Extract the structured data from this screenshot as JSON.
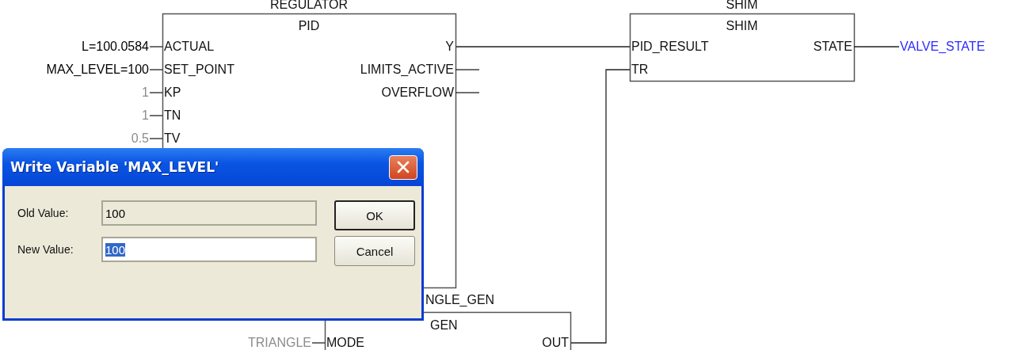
{
  "diagram": {
    "blocks": [
      {
        "instance": "REGULATOR",
        "type": "PID",
        "inputs": [
          {
            "pin": "ACTUAL",
            "value": "L=100.0584",
            "kind": "variable"
          },
          {
            "pin": "SET_POINT",
            "value": "MAX_LEVEL=100",
            "kind": "variable"
          },
          {
            "pin": "KP",
            "value": "1",
            "kind": "constant"
          },
          {
            "pin": "TN",
            "value": "1",
            "kind": "constant"
          },
          {
            "pin": "TV",
            "value": "0.5",
            "kind": "constant"
          }
        ],
        "outputs": [
          {
            "pin": "Y"
          },
          {
            "pin": "LIMITS_ACTIVE"
          },
          {
            "pin": "OVERFLOW"
          }
        ]
      },
      {
        "instance": "SHIM",
        "type": "SHIM",
        "inputs": [
          {
            "pin": "PID_RESULT"
          },
          {
            "pin": "TR"
          }
        ],
        "outputs": [
          {
            "pin": "STATE",
            "value": "VALVE_STATE",
            "kind": "output"
          }
        ]
      },
      {
        "instance": "NGLE_GEN",
        "type": "GEN",
        "inputs": [
          {
            "pin": "MODE",
            "value": "TRIANGLE",
            "kind": "constant"
          }
        ],
        "outputs": [
          {
            "pin": "OUT"
          }
        ]
      }
    ]
  },
  "dialog": {
    "title": "Write Variable 'MAX_LEVEL'",
    "fields": [
      {
        "label": "Old Value:",
        "value": "100",
        "disabled": true,
        "text_selected": false
      },
      {
        "label": "New Value:",
        "value": "100",
        "disabled": false,
        "text_selected": true
      }
    ],
    "buttons": [
      {
        "label": "OK",
        "default": true
      },
      {
        "label": "Cancel",
        "default": false
      }
    ]
  }
}
